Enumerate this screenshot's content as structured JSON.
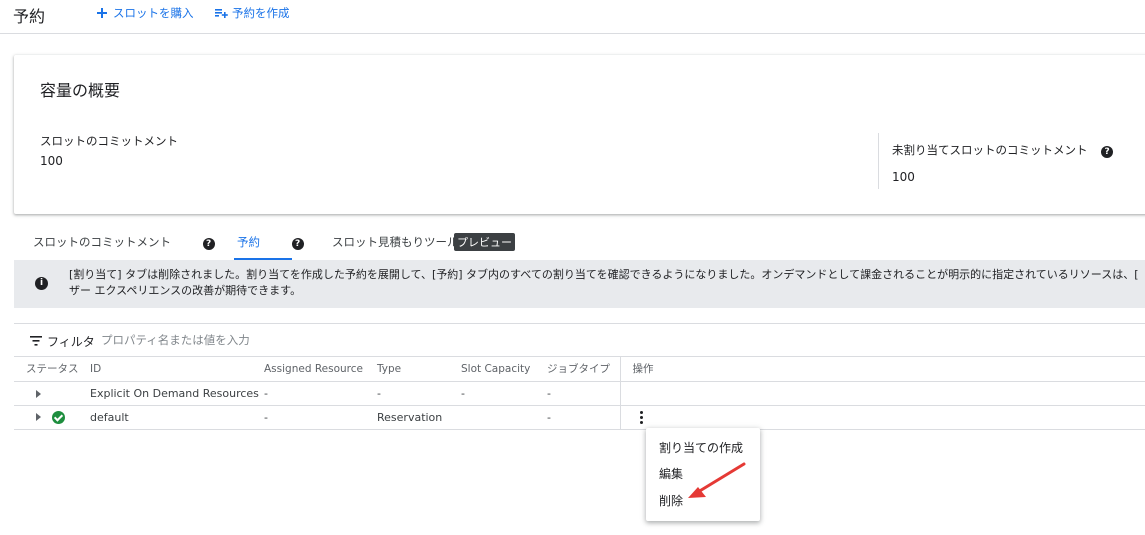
{
  "header": {
    "title": "予約",
    "buy_slots": "スロットを購入",
    "create_reservation": "予約を作成"
  },
  "capacity": {
    "title": "容量の概要",
    "commitment_label": "スロットのコミットメント",
    "commitment_value": "100",
    "unassigned_label": "未割り当てスロットのコミットメント",
    "unassigned_value": "100"
  },
  "tabs": [
    {
      "label": "スロットのコミットメント",
      "active": false
    },
    {
      "label": "予約",
      "active": true
    },
    {
      "label": "スロット見積もりツール",
      "active": false,
      "badge": "プレビュー"
    }
  ],
  "banner": {
    "line1": "[割り当て] タブは削除されました。割り当てを作成した予約を展開して、[予約] タブ内のすべての割り当てを確認できるようになりました。オンデマンドとして課金されることが明示的に指定されているリソースは、[明示的",
    "line2": "ザー エクスペリエンスの改善が期待できます。"
  },
  "filter": {
    "label": "フィルタ",
    "placeholder": "プロパティ名または値を入力"
  },
  "table": {
    "headers": [
      "ステータス",
      "ID",
      "Assigned Resource",
      "Type",
      "Slot Capacity",
      "ジョブタイプ",
      "操作"
    ],
    "rows": [
      {
        "status": "",
        "id": "Explicit On Demand Resources",
        "assigned_resource": "-",
        "type": "-",
        "slot_capacity": "-",
        "job_type": "-"
      },
      {
        "status": "ok",
        "id": "default",
        "assigned_resource": "-",
        "type": "Reservation",
        "slot_capacity": "",
        "job_type": "-"
      }
    ]
  },
  "menu": {
    "items": [
      "割り当ての作成",
      "編集",
      "削除"
    ]
  },
  "colors": {
    "accent": "#1a73e8",
    "status_ok": "#1e8e3e",
    "annotation_arrow": "#e53935"
  }
}
